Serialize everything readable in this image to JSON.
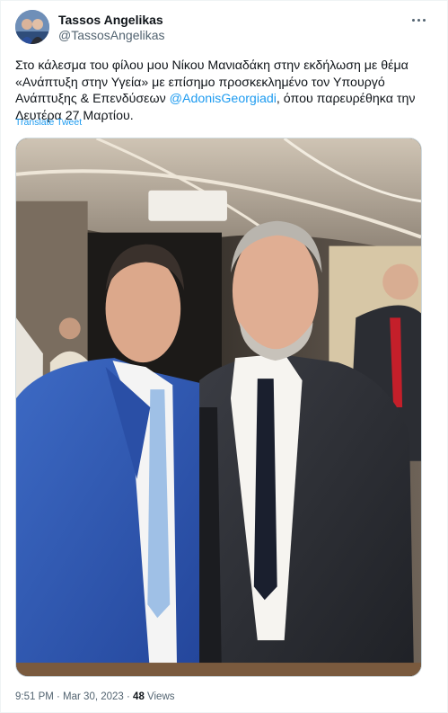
{
  "tweet": {
    "author_name": "Tassos Angelikas",
    "author_handle": "@TassosAngelikas",
    "text_before_mention": "Στο κάλεσμα του φίλου μου Νίκου Μανιαδάκη στην εκδήλωση με θέμα «Ανάπτυξη στην Υγεία» με επίσημο προσκεκλημένο τον Υπουργό Ανάπτυξης & Επενδύσεων ",
    "mention": "@AdonisGeorgiadi",
    "text_after_mention": ", όπου παρευρέθηκα την Δευτέρα 27 Μαρτίου.",
    "translate_label": "Translate Tweet",
    "timestamp": "9:51 PM · Mar 30, 2023 · ",
    "views_count": "48",
    "views_label": " Views"
  },
  "icons": {
    "more": "more-horizontal-icon",
    "avatar": "avatar-image"
  },
  "colors": {
    "link": "#1d9bf0",
    "secondary_text": "#536471",
    "primary_text": "#0f1419"
  }
}
